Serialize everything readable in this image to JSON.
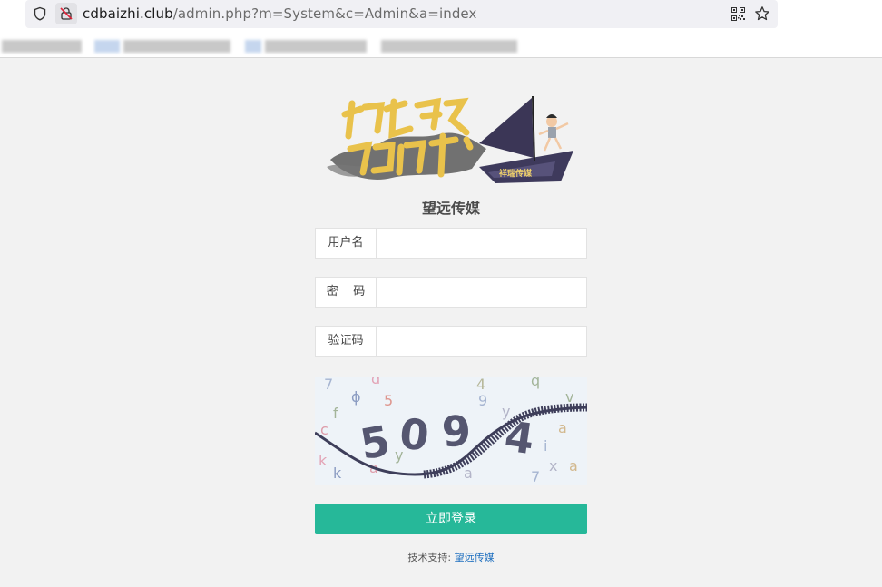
{
  "browser": {
    "url_host": "cdbaizhi.club",
    "url_path": "/admin.php?m=System&c=Admin&a=index",
    "icons": [
      "shield-icon",
      "lock-warning-icon",
      "qr-code-icon",
      "star-icon"
    ]
  },
  "logo": {
    "alt_text": "撸起袖子加油干!",
    "boat_text": "祥瑞传媒"
  },
  "brand": {
    "name": "望远传媒"
  },
  "form": {
    "username_label": "用户名",
    "username_value": "",
    "password_label": "密    码",
    "password_value": "",
    "captcha_label": "验证码",
    "captcha_value": "",
    "captcha_text": "509 4",
    "login_label": "立即登录"
  },
  "footer": {
    "prefix": "技术支持:",
    "link": "望远传媒"
  },
  "colors": {
    "accent": "#26b899",
    "link": "#1e6fbf",
    "page_bg": "#f2f2f2"
  }
}
